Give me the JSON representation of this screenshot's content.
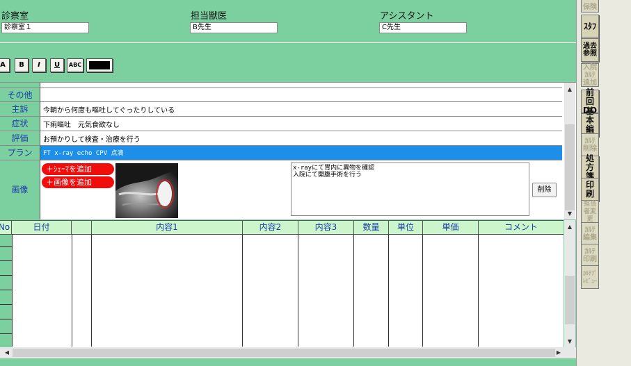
{
  "header": {
    "room_label": "診察室",
    "room_value": "診察室１",
    "doctor_label": "担当獣医",
    "doctor_value": "B先生",
    "assistant_label": "アシスタント",
    "assistant_value": "C先生"
  },
  "format_toolbar": {
    "a_label": "A",
    "bold_label": "B",
    "italic_label": "I",
    "underline_label": "U",
    "strike_label": "ABC",
    "text_color": "#000000"
  },
  "soap": {
    "other_label": "その他",
    "other_value": "",
    "chief_label": "主訴",
    "chief_value": "今朝から何度も嘔吐してぐったりしている",
    "symptom_label": "症状",
    "symptom_value": "下痢嘔吐　元気食欲なし",
    "assessment_label": "評価",
    "assessment_value": "お預かりして検査・治療を行う",
    "plan_label": "プラン",
    "plan_value": "FT x-ray echo CPV 点滴",
    "image_label": "画像",
    "add_schema": "＋ｼｪｰﾏを追加",
    "add_image": "＋画像を追加",
    "image_comment": "x-rayにて胃内に異物を確認\n入院にて開腹手術を行う",
    "delete_label": "削除"
  },
  "table": {
    "columns": [
      "No",
      "日付",
      "",
      "内容1",
      "内容2",
      "内容3",
      "数量",
      "単位",
      "単価",
      "コメント"
    ],
    "rows": []
  },
  "sidebar": {
    "insurance": "保険",
    "input": "ｽﾀﾌ",
    "past_reference": "過去参照",
    "hospital_add": "入院ｶﾙﾃ追加",
    "previous_do": "前回DO",
    "basic_edit": "基本編集",
    "karte_delete": "ｶﾙﾃ削除",
    "prescription": "処方箋",
    "print": "印刷",
    "change_staff": "担当者変更",
    "karte_edit": "ｶﾙﾃ編集",
    "karte_print": "ｶﾙﾃ印刷",
    "karte_preview": "ｶﾙﾃﾌﾟﾚﾋﾞｭｰ"
  },
  "colors": {
    "background": "#7ccf9f",
    "plan_highlight": "#1e8fe8",
    "add_button": "#f20d0d",
    "label_text": "#1a3fa8",
    "table_header": "#ccf5cc"
  }
}
